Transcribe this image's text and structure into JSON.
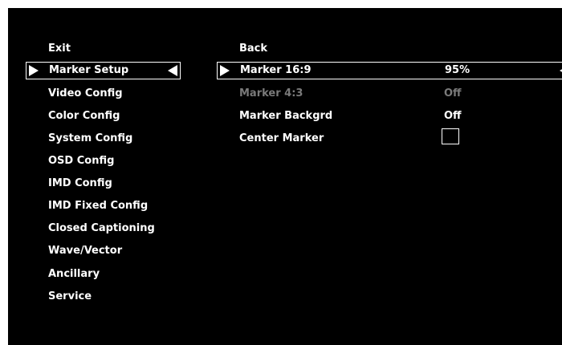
{
  "menu": {
    "items": [
      {
        "label": "Exit"
      },
      {
        "label": "Marker Setup",
        "selected": true
      },
      {
        "label": "Video Config"
      },
      {
        "label": "Color Config"
      },
      {
        "label": "System Config"
      },
      {
        "label": "OSD Config"
      },
      {
        "label": "IMD Config"
      },
      {
        "label": "IMD Fixed Config"
      },
      {
        "label": "Closed Captioning"
      },
      {
        "label": "Wave/Vector"
      },
      {
        "label": "Ancillary"
      },
      {
        "label": "Service"
      }
    ]
  },
  "submenu": {
    "back": "Back",
    "items": [
      {
        "label": "Marker 16:9",
        "value": "95%",
        "selected": true,
        "enabled": true
      },
      {
        "label": "Marker 4:3",
        "value": "Off",
        "selected": false,
        "enabled": false
      },
      {
        "label": "Marker Backgrd",
        "value": "Off",
        "selected": false,
        "enabled": true
      },
      {
        "label": "Center Marker",
        "checked": false,
        "enabled": true
      }
    ]
  },
  "colors": {
    "background": "#000000",
    "text": "#ffffff",
    "disabled": "#7a7a7a"
  }
}
